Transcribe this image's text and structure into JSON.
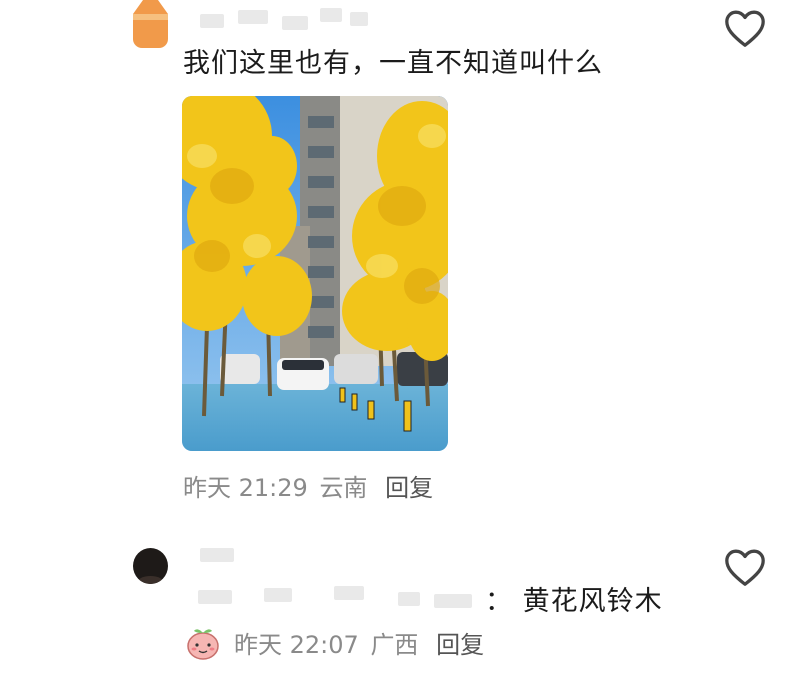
{
  "comments": [
    {
      "text": "我们这里也有，一直不知道叫什么",
      "time": "昨天 21:29",
      "location": "云南",
      "reply_label": "回复",
      "avatar_icon": "cat-avatar-icon",
      "image_alt": "黄花风铃木"
    },
    {
      "text": "：  黄花风铃木",
      "time": "昨天 22:07",
      "location": "广西",
      "reply_label": "回复",
      "avatar_icon": "dark-avatar-icon",
      "badge_icon": "peach-emoji-icon"
    }
  ],
  "colors": {
    "text": "#1b1b1b",
    "meta": "#8a8a8a",
    "reply": "#555555",
    "heart": "#444444",
    "flowers": "#f2c51a",
    "sky": "#5aa8e8"
  }
}
